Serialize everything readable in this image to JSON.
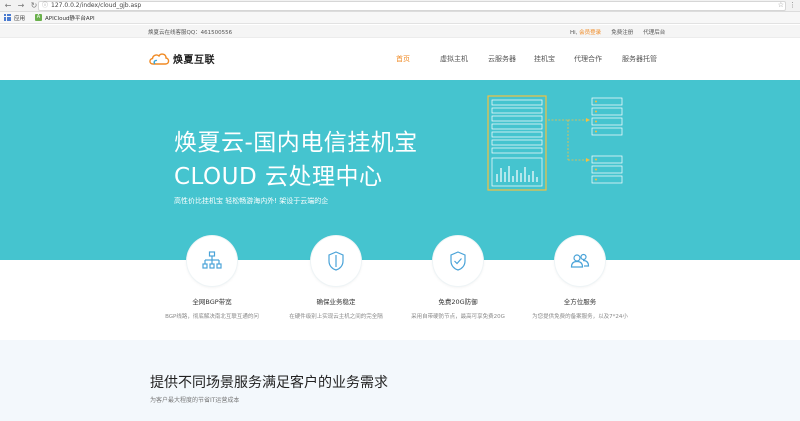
{
  "browser": {
    "url": "127.0.0.2/index/cloud_gjb.asp",
    "info_icon": "info-icon",
    "bookmarks": [
      {
        "label": "应用",
        "icon": "apps-icon"
      },
      {
        "label": "APICloud静平台API",
        "icon": "apicloud-icon"
      }
    ]
  },
  "topbar": {
    "qq_text": "焕夏云在线客服QQ：461500556",
    "greeting": "Hi,",
    "login": "会员登录",
    "register": "免费注册",
    "agent": "代理后台"
  },
  "header": {
    "logo_text": "焕夏互联",
    "nav": [
      "首页",
      "虚拟主机",
      "云服务器",
      "挂机宝",
      "代理合作",
      "服务器托管"
    ],
    "active_index": 0
  },
  "hero": {
    "title_line1": "焕夏云-国内电信挂机宝",
    "title_line2": "CLOUD 云处理中心",
    "subtitle": "高性价比挂机宝 轻松畅游海内外! 架设于云端的企"
  },
  "features": [
    {
      "icon": "network-icon",
      "title": "全网BGP带宽",
      "desc": "BGP线路，彻底解决南北互联互通的问"
    },
    {
      "icon": "shield-icon",
      "title": "确保业务稳定",
      "desc": "在硬件级别上实现云主机之间的完全隔"
    },
    {
      "icon": "shield-check-icon",
      "title": "免费20G防御",
      "desc": "采用自带硬防节点，最高可享免费20G"
    },
    {
      "icon": "users-icon",
      "title": "全方位服务",
      "desc": "为您提供免费的备案服务，以及7*24小"
    }
  ],
  "section2": {
    "title": "提供不同场景服务满足客户的业务需求",
    "subtitle": "为客户最大程度的节省IT运营成本"
  },
  "colors": {
    "hero_bg": "#45c4cf",
    "accent": "#f08a24",
    "server_orange": "#f5c040"
  }
}
